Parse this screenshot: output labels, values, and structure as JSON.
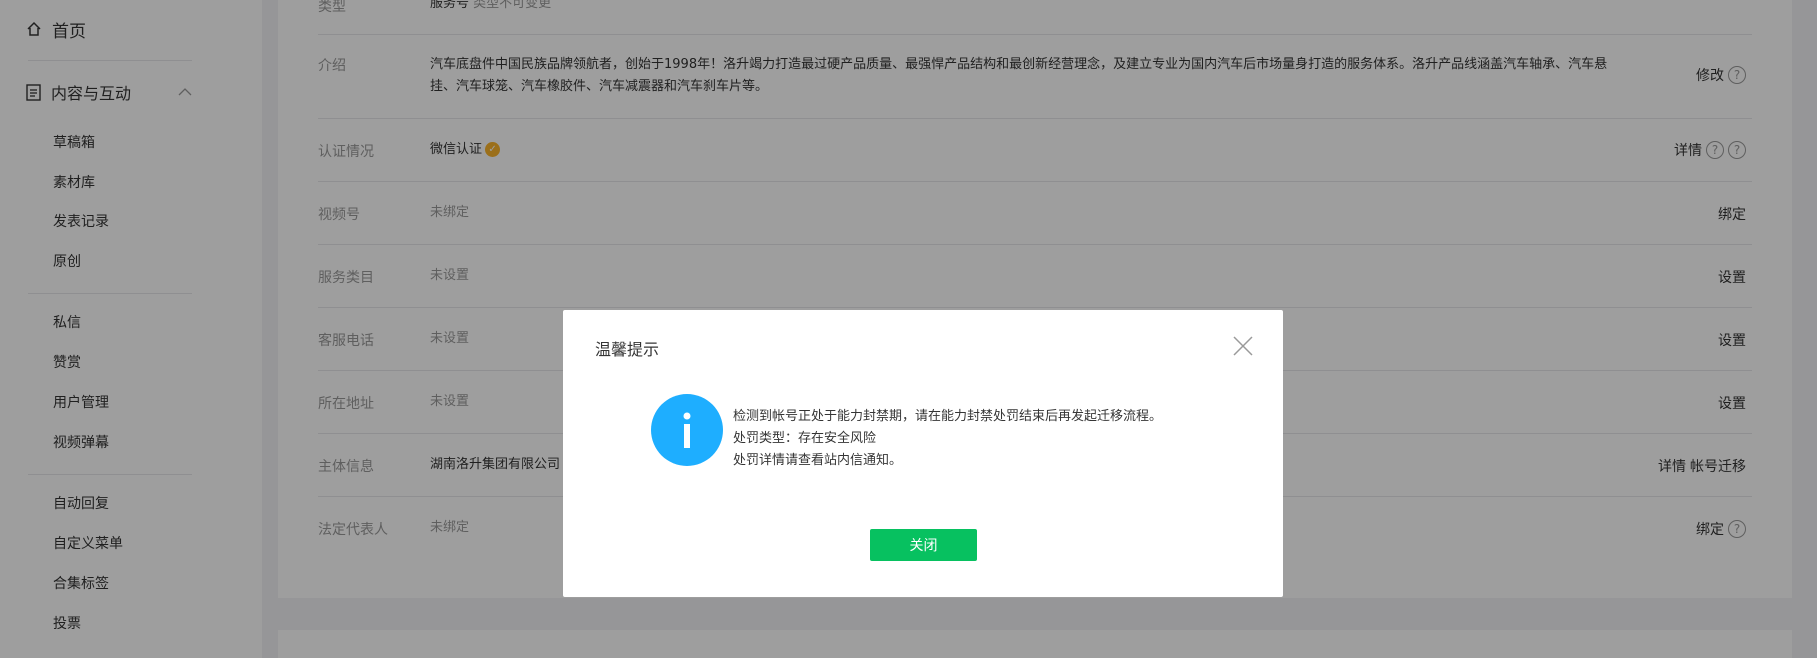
{
  "sidebar": {
    "home_label": "首页",
    "group_label": "内容与互动",
    "items": [
      {
        "label": "草稿箱"
      },
      {
        "label": "素材库"
      },
      {
        "label": "发表记录"
      },
      {
        "label": "原创"
      },
      {
        "label": "私信"
      },
      {
        "label": "赞赏"
      },
      {
        "label": "用户管理"
      },
      {
        "label": "视频弹幕"
      },
      {
        "label": "自动回复"
      },
      {
        "label": "自定义菜单"
      },
      {
        "label": "合集标签"
      },
      {
        "label": "投票"
      }
    ]
  },
  "account": {
    "rows": [
      {
        "label": "类型",
        "value": "服务号",
        "note": "类型不可变更",
        "action": ""
      },
      {
        "label": "介绍",
        "value": "汽车底盘件中国民族品牌领航者，创始于1998年！洛升竭力打造最过硬产品质量、最强悍产品结构和最创新经营理念，及建立专业为国内汽车后市场量身打造的服务体系。洛升产品线涵盖汽车轴承、汽车悬挂、汽车球笼、汽车橡胶件、汽车减震器和汽车刹车片等。",
        "action": "修改"
      },
      {
        "label": "认证情况",
        "value": "微信认证",
        "action": "详情"
      },
      {
        "label": "视频号",
        "value": "未绑定",
        "action": "绑定"
      },
      {
        "label": "服务类目",
        "value": "未设置",
        "action": "设置"
      },
      {
        "label": "客服电话",
        "value": "未设置",
        "action": "设置"
      },
      {
        "label": "所在地址",
        "value": "未设置",
        "action": "设置"
      },
      {
        "label": "主体信息",
        "value": "湖南洛升集团有限公司",
        "action": "详情",
        "action2": "帐号迁移"
      },
      {
        "label": "法定代表人",
        "value": "未绑定",
        "action": "绑定"
      }
    ]
  },
  "dialog": {
    "title": "温馨提示",
    "lines": [
      "检测到帐号正处于能力封禁期，请在能力封禁处罚结束后再发起迁移流程。",
      "处罚类型：存在安全风险",
      "处罚详情请查看站内信通知。"
    ],
    "close_label": "关闭",
    "accent_color": "#07c160",
    "info_color": "#1eaeff"
  }
}
